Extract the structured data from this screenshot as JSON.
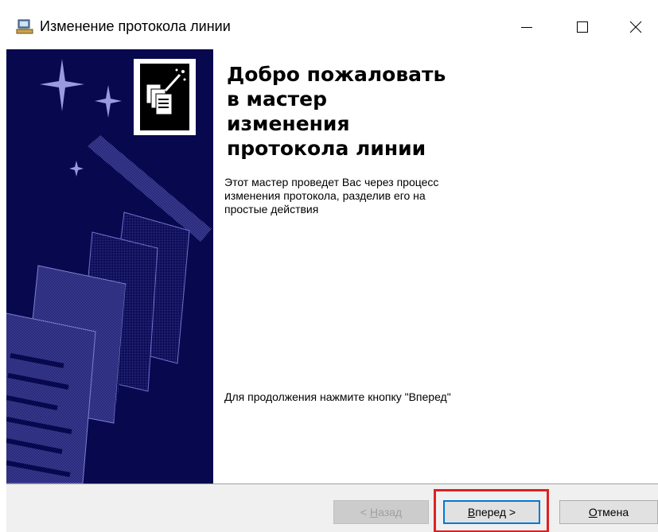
{
  "window": {
    "title": "Изменение протокола линии"
  },
  "icons": {
    "app": "computer-phone-icon",
    "minimize": "minimize-icon",
    "maximize": "maximize-icon",
    "close": "close-icon",
    "wizard": "wizard-documents-icon"
  },
  "content": {
    "heading_lines": [
      "Добро пожаловать",
      "в мастер",
      "изменения",
      "протокола линии"
    ],
    "description_lines": [
      "Этот мастер проведет Вас через процесс",
      "изменения протокола, разделив его на",
      "простые действия"
    ],
    "continue_hint": "Для продолжения нажмите кнопку \"Вперед\""
  },
  "buttons": {
    "back": {
      "prefix": "< ",
      "accel": "Н",
      "rest": "азад",
      "enabled": false
    },
    "next": {
      "accel": "В",
      "rest": "перед >",
      "enabled": true
    },
    "cancel": {
      "accel": "О",
      "rest": "тмена",
      "enabled": true
    }
  },
  "colors": {
    "banner_background": "#08084f",
    "highlight": "#e02020",
    "focus_border": "#0078d7"
  }
}
